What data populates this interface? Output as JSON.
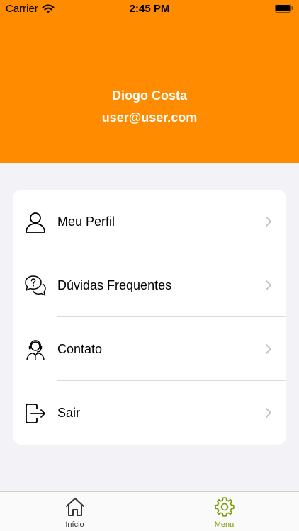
{
  "status_bar": {
    "carrier": "Carrier",
    "time": "2:45 PM"
  },
  "profile": {
    "name": "Diogo Costa",
    "email": "user@user.com"
  },
  "menu": {
    "items": [
      {
        "label": "Meu Perfil",
        "icon": "user-icon"
      },
      {
        "label": "Dúvidas Frequentes",
        "icon": "faq-chat-icon"
      },
      {
        "label": "Contato",
        "icon": "support-agent-icon"
      },
      {
        "label": "Sair",
        "icon": "logout-icon"
      }
    ]
  },
  "tab_bar": {
    "tabs": [
      {
        "label": "Início",
        "icon": "home-icon",
        "active": false
      },
      {
        "label": "Menu",
        "icon": "gear-icon",
        "active": true
      }
    ]
  },
  "colors": {
    "header": "#ff8c00",
    "active_tab": "#7a9a01",
    "inactive_tab": "#333333"
  }
}
